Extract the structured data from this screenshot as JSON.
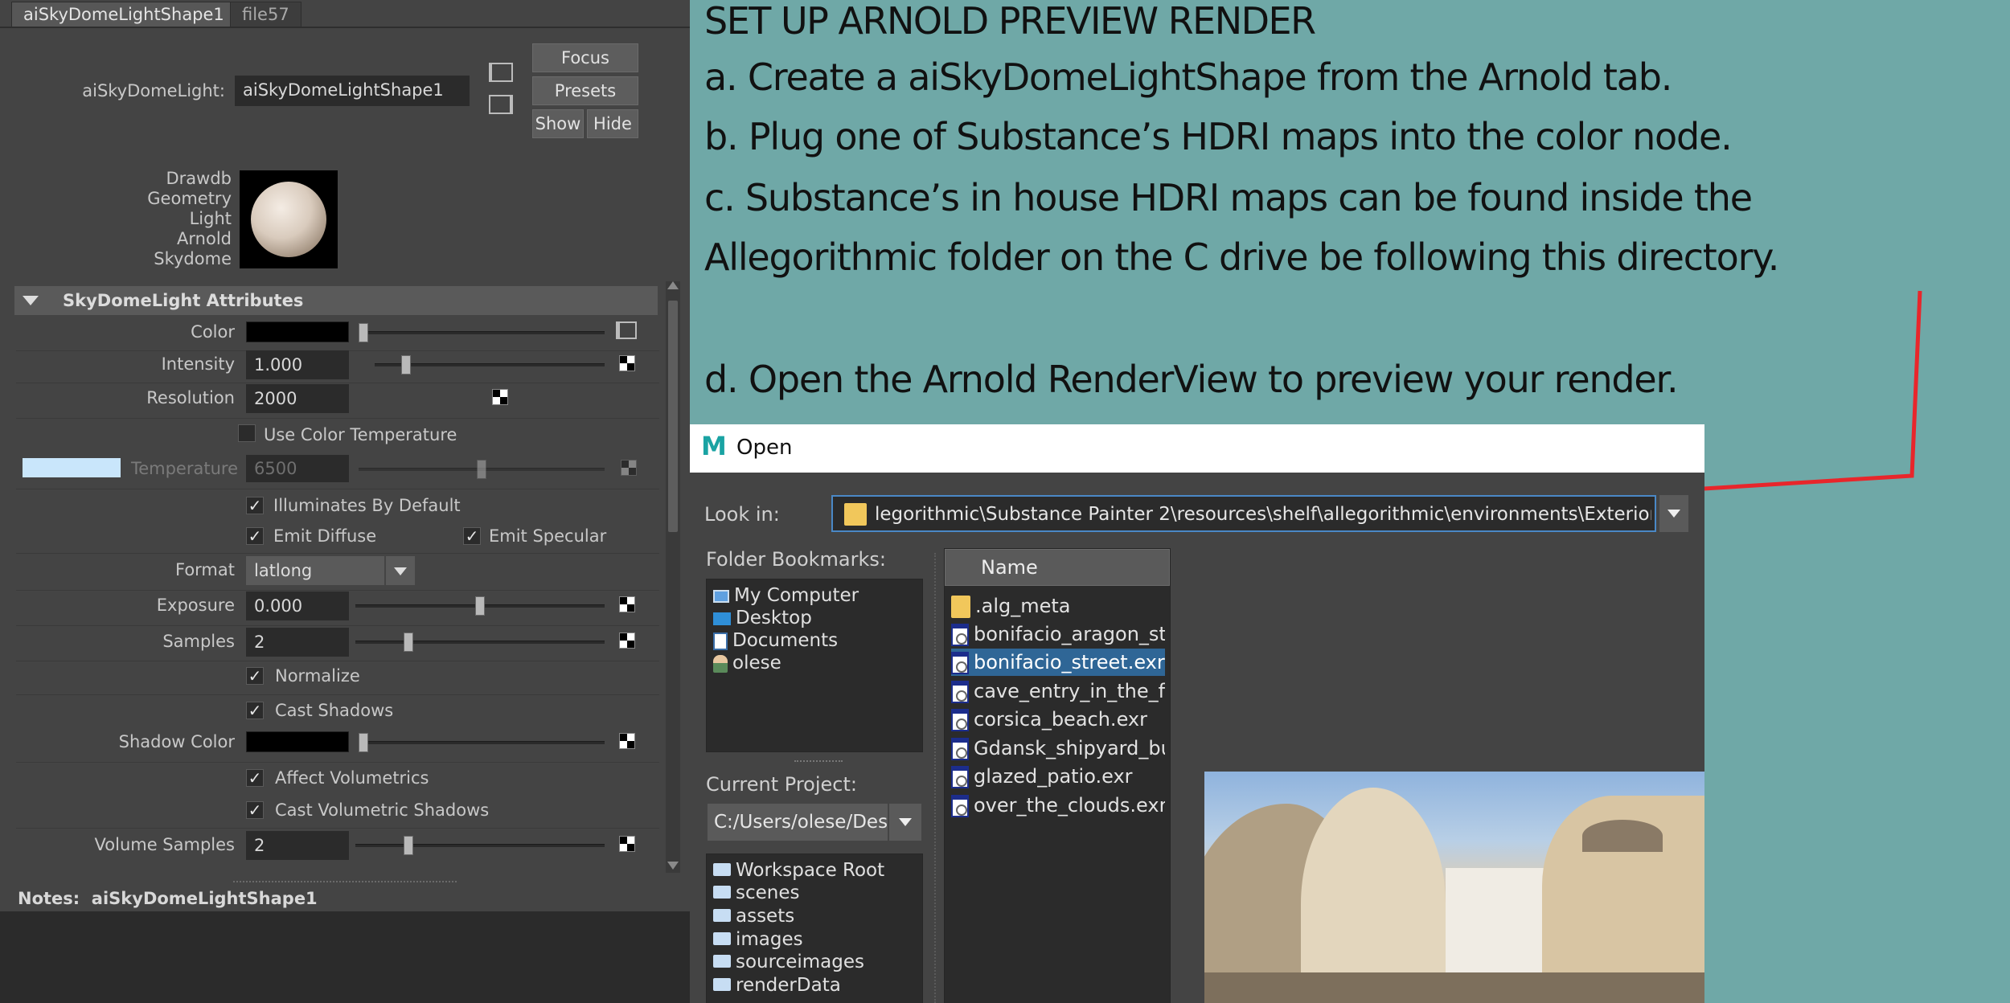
{
  "attribute_editor": {
    "tabs": [
      "aiSkyDomeLightShape1",
      "file57"
    ],
    "node_label": "aiSkyDomeLight:",
    "node_name": "aiSkyDomeLightShape1",
    "buttons": {
      "focus": "Focus",
      "presets": "Presets",
      "show": "Show",
      "hide": "Hide"
    },
    "swatch_labels": [
      "Drawdb",
      "Geometry",
      "Light",
      "Arnold",
      "Skydome"
    ],
    "section_title": "SkyDomeLight Attributes",
    "color_label": "Color",
    "intensity": {
      "label": "Intensity",
      "value": "1.000",
      "level": 0.12
    },
    "resolution": {
      "label": "Resolution",
      "value": "2000"
    },
    "use_color_temperature": {
      "label": "Use Color Temperature",
      "checked": false
    },
    "temperature": {
      "label": "Temperature",
      "value": "6500",
      "level": 0.5
    },
    "illuminates_by_default": {
      "label": "Illuminates By Default",
      "checked": true
    },
    "emit_diffuse": {
      "label": "Emit Diffuse",
      "checked": true
    },
    "emit_specular": {
      "label": "Emit Specular",
      "checked": true
    },
    "format": {
      "label": "Format",
      "value": "latlong"
    },
    "exposure": {
      "label": "Exposure",
      "value": "0.000",
      "level": 0.5
    },
    "samples": {
      "label": "Samples",
      "value": "2",
      "level": 0.2
    },
    "normalize": {
      "label": "Normalize",
      "checked": true
    },
    "cast_shadows": {
      "label": "Cast Shadows",
      "checked": true
    },
    "shadow_color_label": "Shadow Color",
    "affect_volumetrics": {
      "label": "Affect Volumetrics",
      "checked": true
    },
    "cast_volumetric_shadows": {
      "label": "Cast Volumetric Shadows",
      "checked": true
    },
    "volume_samples": {
      "label": "Volume Samples",
      "value": "2",
      "level": 0.2
    },
    "notes": "Notes:  aiSkyDomeLightShape1"
  },
  "instructions": [
    "SET UP ARNOLD PREVIEW RENDER",
    "a. Create a aiSkyDomeLightShape from the Arnold tab.",
    "b. Plug one of Substance’s HDRI maps into the color node.",
    "c. Substance’s in house HDRI maps can be found inside the",
    "Allegorithmic folder on the C drive be following this directory.",
    "d. Open the Arnold RenderView to preview your render."
  ],
  "open_dialog": {
    "title": "Open",
    "app_icon_letter": "M",
    "look_in_label": "Look in:",
    "look_in_path": "legorithmic\\Substance Painter 2\\resources\\shelf\\allegorithmic\\environments\\Exterior",
    "folder_bookmarks_label": "Folder Bookmarks:",
    "bookmarks": [
      "My Computer",
      "Desktop",
      "Documents",
      "olese"
    ],
    "current_project_label": "Current Project:",
    "current_project": "C:/Users/olese/Des",
    "project_folders": [
      "Workspace Root",
      "scenes",
      "assets",
      "images",
      "sourceimages",
      "renderData"
    ],
    "name_header": "Name",
    "files": [
      ".alg_meta",
      "bonifacio_aragon_sta",
      "bonifacio_street.exr",
      "cave_entry_in_the_for",
      "corsica_beach.exr",
      "Gdansk_shipyard_bui",
      "glazed_patio.exr",
      "over_the_clouds.exr"
    ],
    "selected_file": "bonifacio_street.exr"
  },
  "colors": {
    "annotation_line": "#e8262b",
    "background": "#6fa8a7",
    "selection": "#2f6696"
  }
}
